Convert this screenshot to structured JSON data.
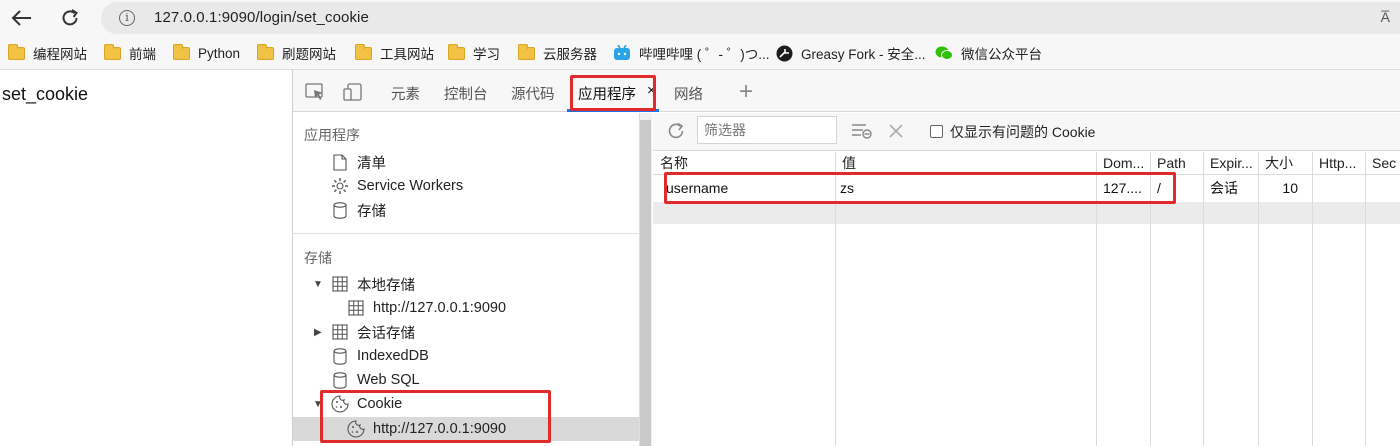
{
  "browser": {
    "url": "127.0.0.1:9090/login/set_cookie",
    "reader_icon": "A̅",
    "bookmarks": [
      {
        "label": "编程网站",
        "icon": "folder-icon"
      },
      {
        "label": "前端",
        "icon": "folder-icon"
      },
      {
        "label": "Python",
        "icon": "folder-icon"
      },
      {
        "label": "刷题网站",
        "icon": "folder-icon"
      },
      {
        "label": "工具网站",
        "icon": "folder-icon"
      },
      {
        "label": "学习",
        "icon": "folder-icon"
      },
      {
        "label": "云服务器",
        "icon": "folder-icon"
      },
      {
        "label": "哔哩哔哩 ( ゜- ゜)つ...",
        "icon": "bilibili-icon"
      },
      {
        "label": "Greasy Fork - 安全...",
        "icon": "greasyfork-icon"
      },
      {
        "label": "微信公众平台",
        "icon": "wechat-icon"
      }
    ]
  },
  "page": {
    "body_text": "set_cookie"
  },
  "devtools": {
    "tabs": [
      {
        "label": "元素"
      },
      {
        "label": "控制台"
      },
      {
        "label": "源代码"
      },
      {
        "label": "应用程序",
        "active": true
      },
      {
        "label": "网络"
      }
    ],
    "tab_close": "×",
    "add_tab": "+",
    "sidebar": {
      "app_section_title": "应用程序",
      "app_items": [
        "清单",
        "Service Workers",
        "存储"
      ],
      "storage_section_title": "存储",
      "local_storage": "本地存储",
      "local_storage_origin": "http://127.0.0.1:9090",
      "session_storage": "会话存储",
      "indexeddb": "IndexedDB",
      "web_sql": "Web SQL",
      "cookie": "Cookie",
      "cookie_origin": "http://127.0.0.1:9090"
    },
    "toolbar": {
      "filter_placeholder": "筛选器",
      "only_issues_label": "仅显示有问题的 Cookie",
      "only_issues_checked": false
    },
    "cookie_table": {
      "columns": [
        "名称",
        "值",
        "Dom...",
        "Path",
        "Expir...",
        "大小",
        "Http...",
        "Sec"
      ],
      "rows": [
        {
          "name": "username",
          "value": "zs",
          "domain": "127....",
          "path": "/",
          "expires": "会话",
          "size": "10",
          "http": "",
          "secure": ""
        }
      ]
    },
    "colors": {
      "highlight": "#e12a2a",
      "active_tab": "#1a73e8",
      "selected_row": "#d9d9d9"
    }
  }
}
